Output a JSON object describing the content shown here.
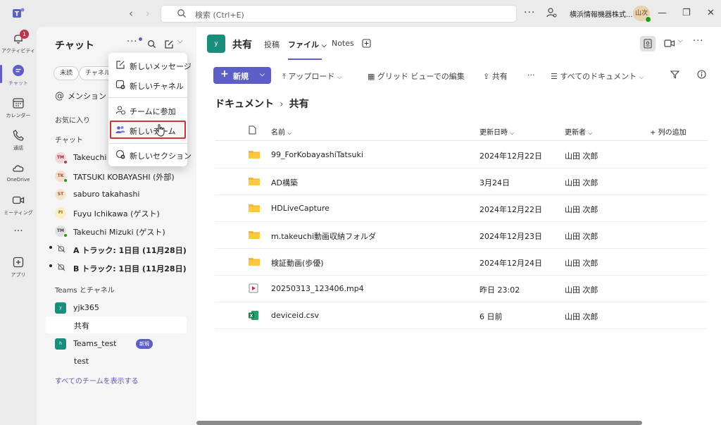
{
  "titlebar": {
    "search_placeholder": "検索 (Ctrl+E)",
    "org_name": "横浜情報機器株式...",
    "avatar_initials": "山次",
    "more": "···"
  },
  "rail": {
    "items": [
      {
        "label": "アクティビティ",
        "icon": "bell-icon",
        "badge": "1"
      },
      {
        "label": "チャット",
        "icon": "chat-icon"
      },
      {
        "label": "カレンダー",
        "icon": "calendar-icon"
      },
      {
        "label": "通話",
        "icon": "phone-icon"
      },
      {
        "label": "OneDrive",
        "icon": "cloud-icon"
      },
      {
        "label": "ミーティング",
        "icon": "video-icon"
      },
      {
        "label": "···",
        "icon": "more-icon"
      },
      {
        "label": "アプリ",
        "icon": "apps-icon"
      }
    ]
  },
  "chatpanel": {
    "title": "チャット",
    "chips": [
      "未読",
      "チャネル"
    ],
    "mention": "メンション",
    "favorites_header": "お気に入り",
    "chat_header": "チャット",
    "chats": [
      {
        "name": "Takeuchi M",
        "initials": "TM",
        "avatar_bg": "#f3d6d8",
        "avatar_fg": "#a4262c",
        "status": "#c4314b"
      },
      {
        "name": "TATSUKI KOBAYASHI (外部)",
        "initials": "TK",
        "avatar_bg": "#f9dfc9",
        "avatar_fg": "#8e562e",
        "status": "#13a10e"
      },
      {
        "name": "saburo takahashi",
        "initials": "ST",
        "avatar_bg": "#f5e4d0",
        "avatar_fg": "#8e562e",
        "status": ""
      },
      {
        "name": "Fuyu Ichikawa (ゲスト)",
        "initials": "FI",
        "avatar_bg": "#fbeec2",
        "avatar_fg": "#8a6d00",
        "status": ""
      },
      {
        "name": "Takeuchi Mizuki (ゲスト)",
        "initials": "TM",
        "avatar_bg": "#e0e0e0",
        "avatar_fg": "#424242",
        "status": "#13a10e"
      }
    ],
    "meetings": [
      {
        "name": "A トラック: 1日目 (11月28日)"
      },
      {
        "name": "B トラック: 1日目 (11月28日)"
      }
    ],
    "teams_header": "Teams とチャネル",
    "teams": [
      {
        "name": "yjk365",
        "initials": "y",
        "channels": [
          "共有"
        ]
      },
      {
        "name": "Teams_test",
        "initials": "h",
        "badge": "新規",
        "channels": [
          "test"
        ]
      }
    ],
    "show_all": "すべてのチームを表示する"
  },
  "menu": {
    "items": [
      {
        "label": "新しいメッセージ",
        "icon": "compose-icon"
      },
      {
        "label": "新しいチャネル",
        "icon": "new-channel-icon"
      },
      {
        "label": "チームに参加",
        "icon": "join-team-icon"
      },
      {
        "label": "新しいチーム",
        "icon": "new-team-icon"
      },
      {
        "label": "新しいセクション",
        "icon": "new-section-icon"
      }
    ]
  },
  "main": {
    "team_initial": "y",
    "title": "共有",
    "tabs": [
      "投稿",
      "ファイル",
      "Notes"
    ],
    "commands": {
      "new": "新規",
      "upload": "アップロード",
      "grid_edit": "グリッド ビューでの編集",
      "share": "共有",
      "more": "···",
      "all_docs": "すべてのドキュメント"
    },
    "breadcrumb": [
      "ドキュメント",
      "共有"
    ],
    "columns": {
      "name": "名前",
      "modified": "更新日時",
      "modified_by": "更新者",
      "add_column": "列の追加"
    },
    "files": [
      {
        "name": "99_ForKobayashiTatsuki",
        "type": "folder",
        "modified": "2024年12月22日",
        "by": "山田 次郎"
      },
      {
        "name": "AD構築",
        "type": "folder",
        "modified": "3月24日",
        "by": "山田 次郎"
      },
      {
        "name": "HDLiveCapture",
        "type": "folder",
        "modified": "2024年12月22日",
        "by": "山田 次郎"
      },
      {
        "name": "m.takeuchi動画収納フォルダ",
        "type": "folder",
        "modified": "2024年12月23日",
        "by": "山田 次郎"
      },
      {
        "name": "検証動画(歩優)",
        "type": "folder",
        "modified": "2024年12月24日",
        "by": "山田 次郎"
      },
      {
        "name": "20250313_123406.mp4",
        "type": "video",
        "modified": "昨日 23:02",
        "by": "山田 次郎"
      },
      {
        "name": "deviceid.csv",
        "type": "excel",
        "modified": "6 日前",
        "by": "山田 次郎"
      }
    ]
  }
}
